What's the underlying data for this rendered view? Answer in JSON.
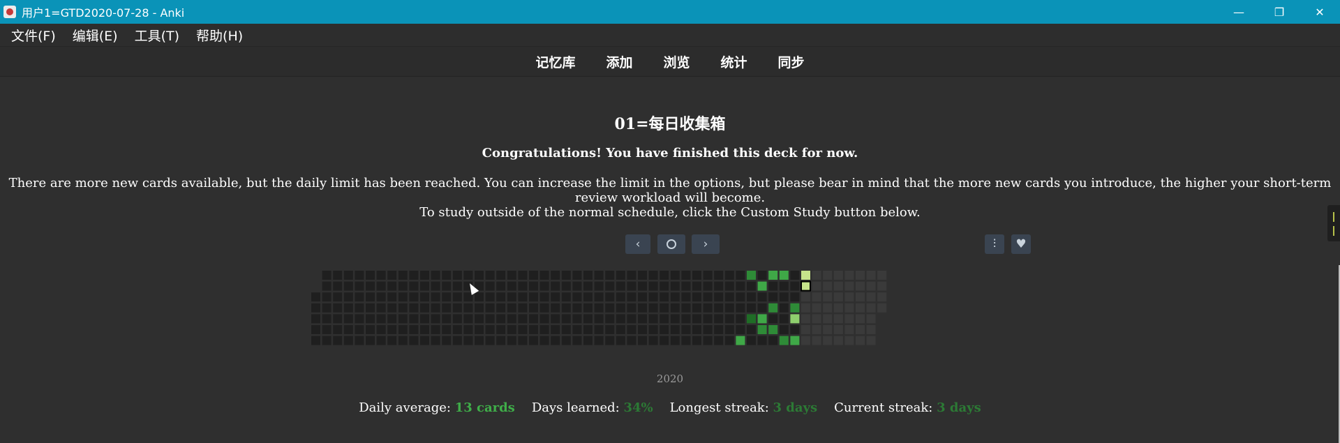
{
  "window": {
    "title": "用户1=GTD2020-07-28 - Anki",
    "minimize_glyph": "—",
    "restore_glyph": "❐",
    "close_glyph": "✕"
  },
  "menu": [
    "文件(F)",
    "编辑(E)",
    "工具(T)",
    "帮助(H)"
  ],
  "toolbar": [
    "记忆库",
    "添加",
    "浏览",
    "统计",
    "同步"
  ],
  "deck": {
    "title": "01=每日收集箱",
    "congrats": "Congratulations! You have finished this deck for now.",
    "info_limit": "There are more new cards available, but the daily limit has been reached. You can increase the limit in the options, but please bear in mind that the more new cards you introduce, the higher your short-term review workload will become.",
    "info_custom": "To study outside of the normal schedule, click the Custom Study button below."
  },
  "heatmap": {
    "year": "2020",
    "buttons": {
      "prev_icon": "chevron-left-icon",
      "today_icon": "circle-icon",
      "next_icon": "chevron-right-icon",
      "options_icon": "sliders-icon",
      "heart_icon": "heart-icon"
    },
    "colors": {
      "empty": "#1f1f1f",
      "future": "#3a3a3a",
      "level1": "#1f6d26",
      "level2": "#2e8b37",
      "level3": "#3fa847",
      "level4": "#8fcf6e",
      "level5": "#c6e48b"
    },
    "weeks": 53,
    "days_per_week": 7,
    "active_cells": [
      {
        "week": 40,
        "day": 0,
        "level": 2
      },
      {
        "week": 41,
        "day": 1,
        "level": 3
      },
      {
        "week": 42,
        "day": 0,
        "level": 3
      },
      {
        "week": 43,
        "day": 0,
        "level": 3
      },
      {
        "week": 45,
        "day": 0,
        "level": 5
      },
      {
        "week": 45,
        "day": 1,
        "level": 5
      },
      {
        "week": 42,
        "day": 3,
        "level": 2
      },
      {
        "week": 44,
        "day": 3,
        "level": 2
      },
      {
        "week": 40,
        "day": 4,
        "level": 1
      },
      {
        "week": 41,
        "day": 4,
        "level": 3
      },
      {
        "week": 44,
        "day": 4,
        "level": 4
      },
      {
        "week": 41,
        "day": 5,
        "level": 2
      },
      {
        "week": 42,
        "day": 5,
        "level": 2
      },
      {
        "week": 39,
        "day": 6,
        "level": 3
      },
      {
        "week": 43,
        "day": 6,
        "level": 2
      },
      {
        "week": 44,
        "day": 6,
        "level": 3
      }
    ]
  },
  "stats": {
    "daily_average_label": "Daily average:",
    "daily_average_value": "13 cards",
    "days_learned_label": "Days learned:",
    "days_learned_value": "34%",
    "longest_streak_label": "Longest streak:",
    "longest_streak_value": "3 days",
    "current_streak_label": "Current streak:",
    "current_streak_value": "3 days"
  }
}
